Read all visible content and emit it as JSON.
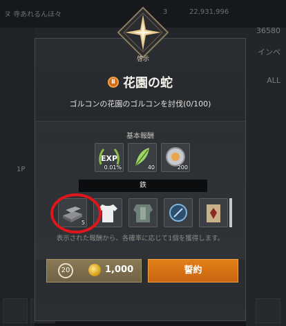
{
  "background": {
    "top_left": "ヌ 寺あれるんほ々",
    "top_gem_value": "3",
    "top_gold_value": "22,931,996",
    "right_items": [
      "36580",
      "インベ",
      "ALL"
    ],
    "left_label": "1P"
  },
  "quest": {
    "emblem_label": "啓示",
    "title_icon": "Ⅱ",
    "title": "花園の蛇",
    "description": "ゴルコンの花園のゴルコンを討伐(0/100)"
  },
  "rewards": {
    "basic_label": "基本報酬",
    "items": [
      {
        "icon": "exp-wreath-icon",
        "count": "0.01%"
      },
      {
        "icon": "herb-leaf-icon",
        "count": "40"
      },
      {
        "icon": "silver-coin-icon",
        "count": "200"
      }
    ],
    "tooltip": "鉄",
    "random_items": [
      {
        "icon": "iron-ingot-icon",
        "count": "5"
      },
      {
        "icon": "white-shirt-icon",
        "count": ""
      },
      {
        "icon": "armor-icon",
        "count": ""
      },
      {
        "icon": "blue-rune-icon",
        "count": ""
      },
      {
        "icon": "scroll-icon",
        "count": ""
      }
    ],
    "footnote": "表示された報酬から、各確率に応じて1個を獲得します。"
  },
  "actions": {
    "cost_badge": "20",
    "price": "1,000",
    "confirm_label": "誓約"
  },
  "colors": {
    "accent_orange": "#e37f18",
    "highlight_red": "#e0161c",
    "gold": "#d9a21e"
  }
}
